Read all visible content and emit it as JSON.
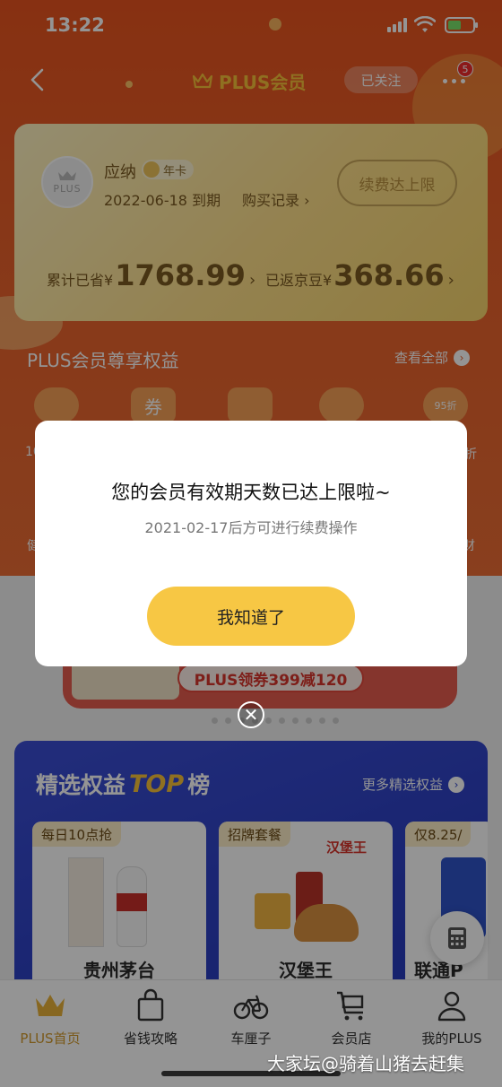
{
  "status_bar": {
    "time": "13:22"
  },
  "nav": {
    "title": "PLUS会员",
    "follow_label": "已关注",
    "more_badge": "5"
  },
  "member_card": {
    "avatar_text": "PLUS",
    "username": "应纳",
    "card_type": "年卡",
    "expire_text": "2022-06-18 到期",
    "purchase_record": "购买记录",
    "renew_button": "续费达上限",
    "saved_label": "累计已省¥",
    "saved_amount": "1768.99",
    "beans_label": "已返京豆¥",
    "beans_amount": "368.66"
  },
  "benefits": {
    "title": "PLUS会员尊享权益",
    "view_all": "查看全部",
    "partial_left": "10",
    "partial_right": "折",
    "partial_left2": "健",
    "partial_right2": "财",
    "coupon_glyph": "券",
    "discount_glyph": "95折"
  },
  "banner": {
    "pill_text": "PLUS领券399减120"
  },
  "top_list": {
    "title_a": "精选权益",
    "title_top": "TOP",
    "title_b": "榜",
    "more_label": "更多精选权益",
    "cards": [
      {
        "tag": "每日10点抢",
        "name": "贵州茅台"
      },
      {
        "tag": "招牌套餐",
        "name": "汉堡王",
        "brand": "汉堡王"
      },
      {
        "tag": "仅8.25/",
        "name": "联通P"
      }
    ]
  },
  "tabbar": {
    "tabs": [
      {
        "label": "PLUS首页",
        "icon": "crown-icon"
      },
      {
        "label": "省钱攻略",
        "icon": "shopping-bag-icon"
      },
      {
        "label": "车厘子",
        "icon": "bicycle-icon"
      },
      {
        "label": "会员店",
        "icon": "cart-icon"
      },
      {
        "label": "我的PLUS",
        "icon": "person-icon"
      }
    ]
  },
  "modal": {
    "title": "您的会员有效期天数已达上限啦~",
    "subtitle": "2021-02-17后方可进行续费操作",
    "button": "我知道了"
  },
  "watermark": "大家坛@骑着山猪去赶集",
  "colors": {
    "hero": "#e9602a",
    "gold": "#f6c13a",
    "modal_button": "#f7c744",
    "top_section": "#2b40c4"
  }
}
